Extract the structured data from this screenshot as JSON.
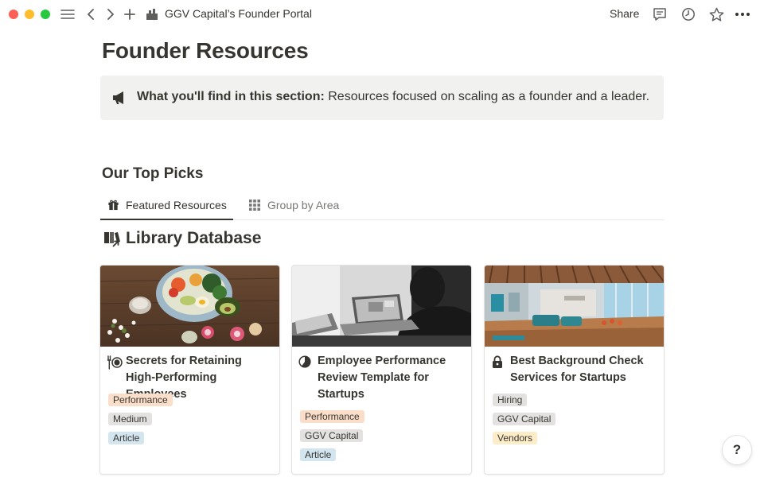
{
  "window": {
    "traffic_lights": {
      "close": "#fe5f57",
      "minimize": "#febc2e",
      "maximize": "#28c840"
    }
  },
  "topbar": {
    "breadcrumb": "GGV Capital’s Founder Portal",
    "share_label": "Share",
    "icons": [
      "sidebar-toggle-icon",
      "back-arrow-icon",
      "forward-arrow-icon",
      "plus-icon",
      "building-icon",
      "comment-icon",
      "clock-icon",
      "star-icon",
      "more-icon"
    ]
  },
  "page": {
    "title": "Founder Resources",
    "callout": {
      "icon": "megaphone-icon",
      "bold": "What you'll find in this section:",
      "text": " Resources focused on scaling as a founder and a leader."
    },
    "section_heading": "Our Top Picks",
    "tabs": [
      {
        "label": "Featured Resources",
        "icon": "gift-icon",
        "active": true
      },
      {
        "label": "Group by Area",
        "icon": "grid-icon",
        "active": false
      }
    ],
    "database_title": "Library Database",
    "cards": [
      {
        "title": "Secrets for Retaining High-Performing Employees",
        "icon": "utensils-icon",
        "tags": [
          {
            "label": "Performance",
            "color": "#fadec9"
          },
          {
            "label": "Medium",
            "color": "#e3e2e0"
          },
          {
            "label": "Article",
            "color": "#d3e5ef"
          }
        ]
      },
      {
        "title": "Employee Performance Review Template for Startups",
        "icon": "pie-chart-icon",
        "tags": [
          {
            "label": "Performance",
            "color": "#fadec9"
          },
          {
            "label": "GGV Capital",
            "color": "#e3e2e0"
          },
          {
            "label": "Article",
            "color": "#d3e5ef"
          }
        ]
      },
      {
        "title": "Best Background Check Services for Startups",
        "icon": "lock-icon",
        "tags": [
          {
            "label": "Hiring",
            "color": "#e3e2e0"
          },
          {
            "label": "GGV Capital",
            "color": "#e3e2e0"
          },
          {
            "label": "Vendors",
            "color": "#fdecc8"
          }
        ]
      }
    ]
  },
  "help_label": "?"
}
